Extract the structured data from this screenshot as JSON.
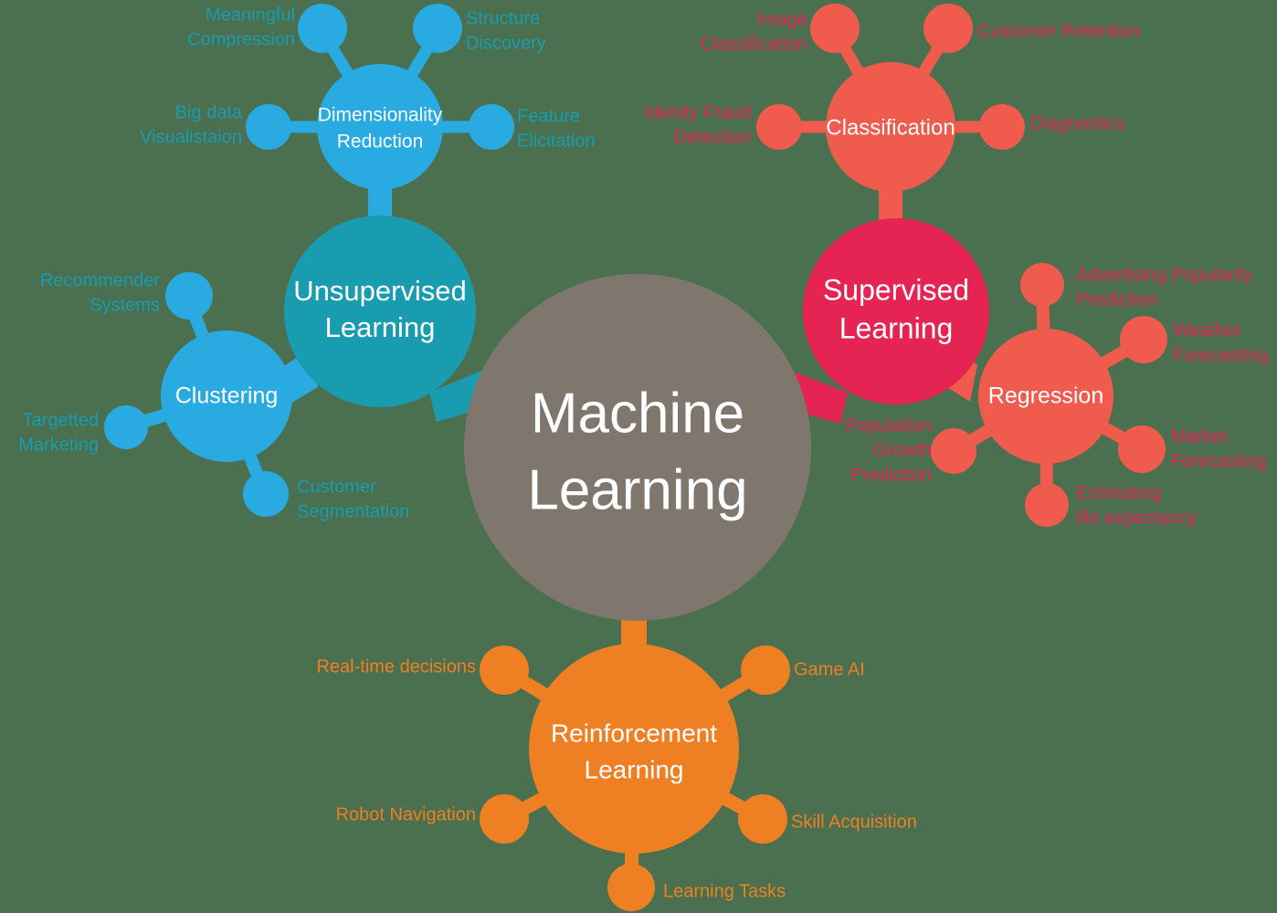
{
  "diagram": {
    "title": "Machine Learning",
    "background_color": "#4a7050",
    "center": {
      "label_line1": "Machine",
      "label_line2": "Learning",
      "color": "#7f776e",
      "text_color": "#ffffff"
    },
    "branches": [
      {
        "id": "unsupervised",
        "label_line1": "Unsupervised",
        "label_line2": "Learning",
        "color": "#1a9cb0",
        "label_color": "#1a9cb0",
        "subgroups": [
          {
            "id": "clustering",
            "label_line1": "Clustering",
            "label_line2": "",
            "color": "#29abe2",
            "label_color": "#1a9cb0",
            "leaves": [
              {
                "line1": "Recommender",
                "line2": "Systems"
              },
              {
                "line1": "Targetted",
                "line2": "Marketing"
              },
              {
                "line1": "Customer",
                "line2": "Segmentation"
              }
            ]
          },
          {
            "id": "dimensionality-reduction",
            "label_line1": "Dimensionality",
            "label_line2": "Reduction",
            "color": "#29abe2",
            "label_color": "#1a9cb0",
            "leaves": [
              {
                "line1": "Meaningful",
                "line2": "Compression"
              },
              {
                "line1": "Structure",
                "line2": "Discovery"
              },
              {
                "line1": "Big data",
                "line2": "Visualistaion"
              },
              {
                "line1": "Feature",
                "line2": "Elicitation"
              }
            ]
          }
        ]
      },
      {
        "id": "supervised",
        "label_line1": "Supervised",
        "label_line2": "Learning",
        "color": "#e52454",
        "label_color": "#e52454",
        "subgroups": [
          {
            "id": "classification",
            "label_line1": "Classification",
            "label_line2": "",
            "color": "#ef5b4c",
            "label_color": "#e52454",
            "leaves": [
              {
                "line1": "Image",
                "line2": "Classification"
              },
              {
                "line1": "Customer Retention",
                "line2": ""
              },
              {
                "line1": "Idenity Fraud",
                "line2": "Detection"
              },
              {
                "line1": "Diagnostics",
                "line2": ""
              }
            ]
          },
          {
            "id": "regression",
            "label_line1": "Regression",
            "label_line2": "",
            "color": "#ef5b4c",
            "label_color": "#e52454",
            "leaves": [
              {
                "line1": "Advertising Popularity",
                "line2": "Prediction"
              },
              {
                "line1": "Weather",
                "line2": "Forecasting"
              },
              {
                "line1": "Market",
                "line2": "Forecasting"
              },
              {
                "line1": "Estimating",
                "line2": "life expectancy"
              },
              {
                "line1": "Population",
                "line2": "Growth",
                "line3": "Prediction"
              }
            ]
          }
        ]
      },
      {
        "id": "reinforcement",
        "label_line1": "Reinforcement",
        "label_line2": "Learning",
        "color": "#ef7f23",
        "label_color": "#ef7f23",
        "subgroups": [],
        "leaves": [
          {
            "line1": "Real-time decisions",
            "line2": ""
          },
          {
            "line1": "Game AI",
            "line2": ""
          },
          {
            "line1": "Robot Navigation",
            "line2": ""
          },
          {
            "line1": "Skill Acquisition",
            "line2": ""
          },
          {
            "line1": "Learning Tasks",
            "line2": ""
          }
        ]
      }
    ]
  },
  "chart_data": {
    "type": "diagram",
    "title": "Machine Learning",
    "root": "Machine Learning",
    "nodes": [
      {
        "name": "Machine Learning",
        "level": 0,
        "parent": null,
        "color": "#7f776e"
      },
      {
        "name": "Unsupervised Learning",
        "level": 1,
        "parent": "Machine Learning",
        "color": "#1a9cb0"
      },
      {
        "name": "Supervised Learning",
        "level": 1,
        "parent": "Machine Learning",
        "color": "#e52454"
      },
      {
        "name": "Reinforcement Learning",
        "level": 1,
        "parent": "Machine Learning",
        "color": "#ef7f23"
      },
      {
        "name": "Clustering",
        "level": 2,
        "parent": "Unsupervised Learning",
        "color": "#29abe2"
      },
      {
        "name": "Dimensionality Reduction",
        "level": 2,
        "parent": "Unsupervised Learning",
        "color": "#29abe2"
      },
      {
        "name": "Classification",
        "level": 2,
        "parent": "Supervised Learning",
        "color": "#ef5b4c"
      },
      {
        "name": "Regression",
        "level": 2,
        "parent": "Supervised Learning",
        "color": "#ef5b4c"
      },
      {
        "name": "Recommender Systems",
        "level": 3,
        "parent": "Clustering"
      },
      {
        "name": "Targetted Marketing",
        "level": 3,
        "parent": "Clustering"
      },
      {
        "name": "Customer Segmentation",
        "level": 3,
        "parent": "Clustering"
      },
      {
        "name": "Meaningful Compression",
        "level": 3,
        "parent": "Dimensionality Reduction"
      },
      {
        "name": "Structure Discovery",
        "level": 3,
        "parent": "Dimensionality Reduction"
      },
      {
        "name": "Big data Visualistaion",
        "level": 3,
        "parent": "Dimensionality Reduction"
      },
      {
        "name": "Feature Elicitation",
        "level": 3,
        "parent": "Dimensionality Reduction"
      },
      {
        "name": "Image Classification",
        "level": 3,
        "parent": "Classification"
      },
      {
        "name": "Customer Retention",
        "level": 3,
        "parent": "Classification"
      },
      {
        "name": "Idenity Fraud Detection",
        "level": 3,
        "parent": "Classification"
      },
      {
        "name": "Diagnostics",
        "level": 3,
        "parent": "Classification"
      },
      {
        "name": "Advertising Popularity Prediction",
        "level": 3,
        "parent": "Regression"
      },
      {
        "name": "Weather Forecasting",
        "level": 3,
        "parent": "Regression"
      },
      {
        "name": "Market Forecasting",
        "level": 3,
        "parent": "Regression"
      },
      {
        "name": "Estimating life expectancy",
        "level": 3,
        "parent": "Regression"
      },
      {
        "name": "Population Growth Prediction",
        "level": 3,
        "parent": "Regression"
      },
      {
        "name": "Real-time decisions",
        "level": 2,
        "parent": "Reinforcement Learning"
      },
      {
        "name": "Game AI",
        "level": 2,
        "parent": "Reinforcement Learning"
      },
      {
        "name": "Robot Navigation",
        "level": 2,
        "parent": "Reinforcement Learning"
      },
      {
        "name": "Skill Acquisition",
        "level": 2,
        "parent": "Reinforcement Learning"
      },
      {
        "name": "Learning Tasks",
        "level": 2,
        "parent": "Reinforcement Learning"
      }
    ]
  }
}
